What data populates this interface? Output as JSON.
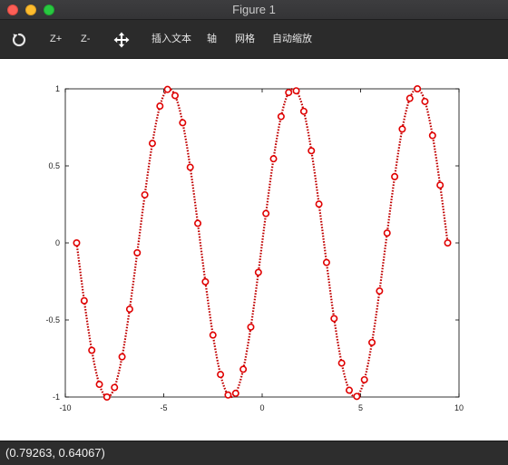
{
  "window": {
    "title": "Figure 1"
  },
  "toolbar": {
    "rotate_icon": "rotate-icon",
    "zoom_in_label": "Z+",
    "zoom_out_label": "Z-",
    "pan_icon": "pan-arrows-icon",
    "insert_text_label": "插入文本",
    "axis_label": "轴",
    "grid_label": "网格",
    "autoscale_label": "自动缩放"
  },
  "status": {
    "coordinates": "(0.79263, 0.64067)"
  },
  "colors": {
    "line": "#c00000",
    "marker": "#e00000"
  },
  "chart_data": {
    "type": "line",
    "x_range": [
      -10,
      10
    ],
    "y_range": [
      -1,
      1
    ],
    "x_ticks": [
      "-10",
      "-5",
      "0",
      "5",
      "10"
    ],
    "y_ticks": [
      "1",
      "0.5",
      "0",
      "-0.5",
      "-1"
    ],
    "line_style": "dotted",
    "marker": "circle",
    "series": [
      {
        "x": [
          -9.4248,
          -9.04,
          -8.655,
          -8.27,
          -7.886,
          -7.501,
          -7.116,
          -6.732,
          -6.347,
          -5.962,
          -5.578,
          -5.193,
          -4.808,
          -4.424,
          -4.039,
          -3.654,
          -3.27,
          -2.885,
          -2.5,
          -2.116,
          -1.731,
          -1.346,
          -0.962,
          -0.577,
          -0.192,
          0.192,
          0.577,
          0.962,
          1.346,
          1.731,
          2.116,
          2.5,
          2.885,
          3.27,
          3.654,
          4.039,
          4.424,
          4.808,
          5.193,
          5.578,
          5.962,
          6.347,
          6.732,
          7.116,
          7.501,
          7.886,
          8.27,
          8.655,
          9.04,
          9.4248
        ],
        "y": [
          0.0,
          -0.375,
          -0.697,
          -0.918,
          -1.0,
          -0.938,
          -0.739,
          -0.43,
          -0.064,
          0.312,
          0.646,
          0.888,
          0.996,
          0.956,
          0.78,
          0.491,
          0.127,
          -0.252,
          -0.598,
          -0.854,
          -0.987,
          -0.976,
          -0.82,
          -0.546,
          -0.191,
          0.191,
          0.546,
          0.82,
          0.976,
          0.987,
          0.854,
          0.598,
          0.252,
          -0.127,
          -0.491,
          -0.78,
          -0.956,
          -0.996,
          -0.888,
          -0.646,
          -0.312,
          0.064,
          0.43,
          0.739,
          0.938,
          1.0,
          0.918,
          0.697,
          0.375,
          0.0
        ]
      }
    ]
  }
}
